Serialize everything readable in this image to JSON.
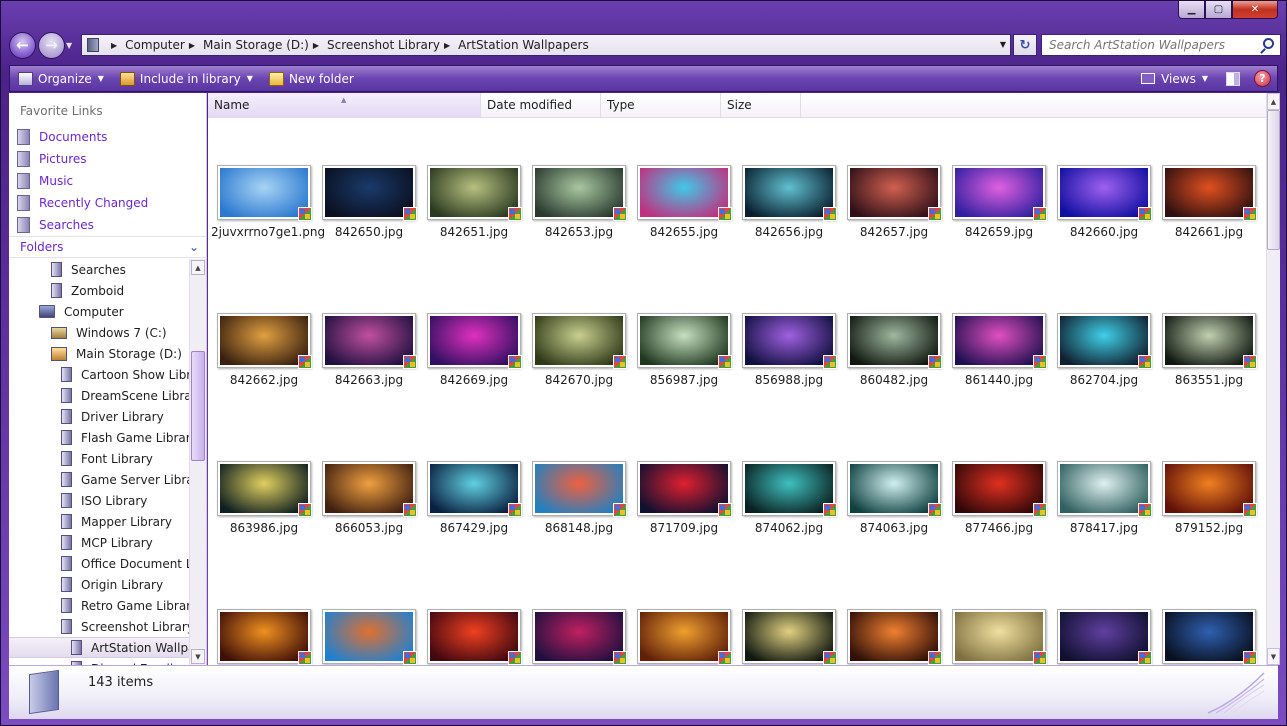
{
  "window": {
    "controls": {
      "minimize": "▁",
      "maximize": "▢",
      "close": "✕"
    }
  },
  "address_bar": {
    "breadcrumbs": [
      "Computer",
      "Main Storage (D:)",
      "Screenshot Library",
      "ArtStation Wallpapers"
    ]
  },
  "search": {
    "placeholder": "Search ArtStation Wallpapers"
  },
  "toolbar": {
    "organize": "Organize",
    "include_in_library": "Include in library",
    "new_folder": "New folder",
    "views": "Views",
    "help": "?"
  },
  "navigation": {
    "favorite_links_title": "Favorite Links",
    "favorites": [
      "Documents",
      "Pictures",
      "Music",
      "Recently Changed",
      "Searches"
    ],
    "folders_label": "Folders",
    "tree": [
      {
        "label": "Searches",
        "indent": 1
      },
      {
        "label": "Zomboid",
        "indent": 1
      },
      {
        "label": "Computer",
        "indent": 0,
        "icon": "computer-icon"
      },
      {
        "label": "Windows 7 (C:)",
        "indent": 1,
        "icon": "drive-icon"
      },
      {
        "label": "Main Storage (D:)",
        "indent": 1,
        "icon": "drive-icon"
      },
      {
        "label": "Cartoon Show Library",
        "indent": 2
      },
      {
        "label": "DreamScene Library",
        "indent": 2
      },
      {
        "label": "Driver Library",
        "indent": 2
      },
      {
        "label": "Flash Game Library",
        "indent": 2
      },
      {
        "label": "Font Library",
        "indent": 2
      },
      {
        "label": "Game Server Library",
        "indent": 2
      },
      {
        "label": "ISO Library",
        "indent": 2
      },
      {
        "label": "Mapper Library",
        "indent": 2
      },
      {
        "label": "MCP Library",
        "indent": 2
      },
      {
        "label": "Office Document Library",
        "indent": 2
      },
      {
        "label": "Origin Library",
        "indent": 2
      },
      {
        "label": "Retro Game Library",
        "indent": 2
      },
      {
        "label": "Screenshot Library",
        "indent": 2
      },
      {
        "label": "ArtStation Wallpapers",
        "indent": 3,
        "selected": true
      },
      {
        "label": "Discord Emoji",
        "indent": 3
      }
    ]
  },
  "columns": [
    "Name",
    "Date modified",
    "Type",
    "Size"
  ],
  "files": [
    {
      "name": "2juvxrrno7ge1.png",
      "c1": "#a8d4f4",
      "c2": "#2a78d0"
    },
    {
      "name": "842650.jpg",
      "c1": "#1a3a6a",
      "c2": "#0a1020"
    },
    {
      "name": "842651.jpg",
      "c1": "#b8c080",
      "c2": "#2a3a20"
    },
    {
      "name": "842653.jpg",
      "c1": "#a8c8a0",
      "c2": "#2a3a30"
    },
    {
      "name": "842655.jpg",
      "c1": "#40c8e8",
      "c2": "#c03080"
    },
    {
      "name": "842656.jpg",
      "c1": "#60c0d0",
      "c2": "#0a2030"
    },
    {
      "name": "842657.jpg",
      "c1": "#d06050",
      "c2": "#301018"
    },
    {
      "name": "842659.jpg",
      "c1": "#e060e0",
      "c2": "#3020a0"
    },
    {
      "name": "842660.jpg",
      "c1": "#a060f0",
      "c2": "#1010a0"
    },
    {
      "name": "842661.jpg",
      "c1": "#e05020",
      "c2": "#301010"
    },
    {
      "name": "842662.jpg",
      "c1": "#e0a040",
      "c2": "#3a2010"
    },
    {
      "name": "842663.jpg",
      "c1": "#c050a0",
      "c2": "#201040"
    },
    {
      "name": "842669.jpg",
      "c1": "#e030c0",
      "c2": "#301060"
    },
    {
      "name": "842670.jpg",
      "c1": "#c8d090",
      "c2": "#303818"
    },
    {
      "name": "856987.jpg",
      "c1": "#c8e0c0",
      "c2": "#203820"
    },
    {
      "name": "856988.jpg",
      "c1": "#a060e0",
      "c2": "#101040"
    },
    {
      "name": "860482.jpg",
      "c1": "#a0b8a0",
      "c2": "#101810"
    },
    {
      "name": "861440.jpg",
      "c1": "#e050c0",
      "c2": "#201050"
    },
    {
      "name": "862704.jpg",
      "c1": "#40d0e8",
      "c2": "#102030"
    },
    {
      "name": "863551.jpg",
      "c1": "#c0d0b0",
      "c2": "#101810"
    },
    {
      "name": "863986.jpg",
      "c1": "#e0d060",
      "c2": "#102020"
    },
    {
      "name": "866053.jpg",
      "c1": "#f0a040",
      "c2": "#402010"
    },
    {
      "name": "867429.jpg",
      "c1": "#60d0e0",
      "c2": "#0a2040"
    },
    {
      "name": "868148.jpg",
      "c1": "#f06040",
      "c2": "#2080c0"
    },
    {
      "name": "871709.jpg",
      "c1": "#e02030",
      "c2": "#101030"
    },
    {
      "name": "874062.jpg",
      "c1": "#40c0c0",
      "c2": "#0a2020"
    },
    {
      "name": "874063.jpg",
      "c1": "#d0f0f0",
      "c2": "#104040"
    },
    {
      "name": "877466.jpg",
      "c1": "#e03020",
      "c2": "#300808"
    },
    {
      "name": "878417.jpg",
      "c1": "#e0f0f0",
      "c2": "#306060"
    },
    {
      "name": "879152.jpg",
      "c1": "#f08020",
      "c2": "#601008"
    },
    {
      "name": "",
      "c1": "#f09020",
      "c2": "#401008"
    },
    {
      "name": "",
      "c1": "#e07030",
      "c2": "#2080d0"
    },
    {
      "name": "",
      "c1": "#f04020",
      "c2": "#400810"
    },
    {
      "name": "",
      "c1": "#c02060",
      "c2": "#201040"
    },
    {
      "name": "",
      "c1": "#f0a030",
      "c2": "#602008"
    },
    {
      "name": "",
      "c1": "#e0d080",
      "c2": "#101810"
    },
    {
      "name": "",
      "c1": "#f08030",
      "c2": "#301008"
    },
    {
      "name": "",
      "c1": "#f0e0a0",
      "c2": "#807040"
    },
    {
      "name": "",
      "c1": "#6040a0",
      "c2": "#101030"
    },
    {
      "name": "",
      "c1": "#3060b0",
      "c2": "#081020"
    }
  ],
  "status": {
    "item_count": "143 items"
  }
}
